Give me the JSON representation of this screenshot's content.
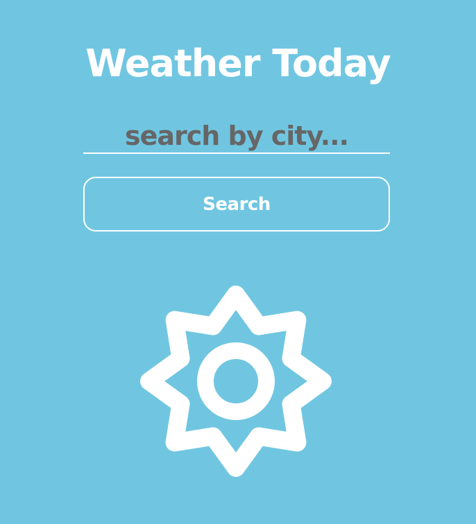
{
  "app": {
    "title": "Weather Today"
  },
  "search": {
    "placeholder": "search by city...",
    "value": "",
    "button_label": "Search"
  },
  "weather": {
    "icon": "sun-icon"
  },
  "colors": {
    "background": "#70c6e1",
    "foreground": "#ffffff",
    "placeholder": "#666666"
  }
}
